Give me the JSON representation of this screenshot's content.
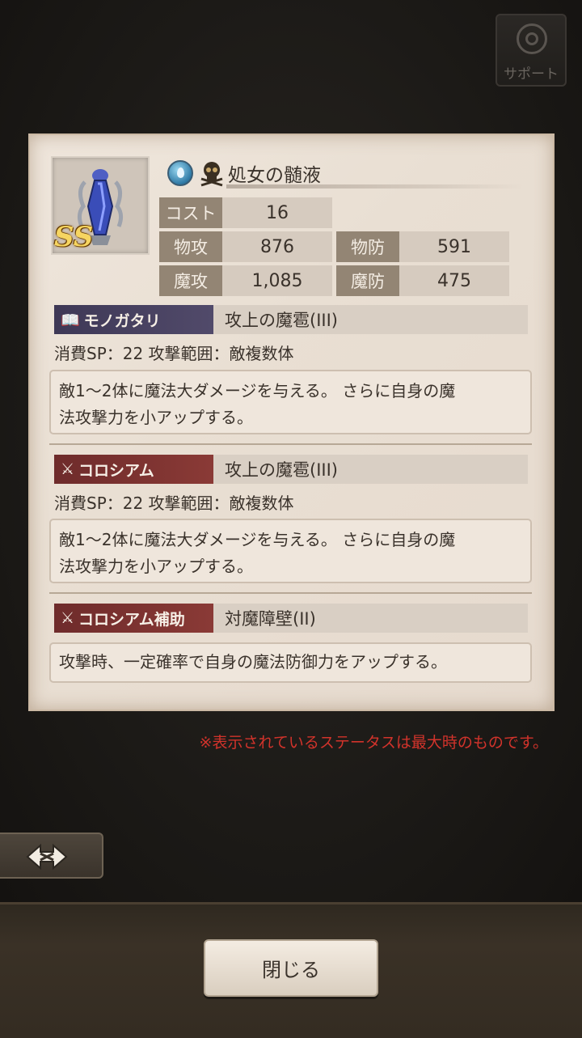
{
  "support": {
    "label": "サポート",
    "icon": "headset-icon"
  },
  "item": {
    "name": "処女の髄液",
    "rank": "SS",
    "element_icon": "water-drop-icon",
    "type_icon": "skull-icon"
  },
  "stats": {
    "cost": {
      "label": "コスト",
      "value": "16"
    },
    "patk": {
      "label": "物攻",
      "value": "876"
    },
    "pdef": {
      "label": "物防",
      "value": "591"
    },
    "matk": {
      "label": "魔攻",
      "value": "1,085"
    },
    "mdef": {
      "label": "魔防",
      "value": "475"
    }
  },
  "story_skill": {
    "tag": "モノガタリ",
    "tag_icon": "book-icon",
    "name": "攻上の魔雹(III)",
    "sp_line": "消費SP：22 攻撃範囲：敵複数体",
    "desc_line1": "敵1～2体に魔法大ダメージを与える。 さらに自身の魔",
    "desc_line2": "法攻撃力を小アップする。"
  },
  "colo_skill": {
    "tag": "コロシアム",
    "tag_icon": "crossed-swords-icon",
    "name": "攻上の魔雹(III)",
    "sp_line": "消費SP：22 攻撃範囲：敵複数体",
    "desc_line1": "敵1～2体に魔法大ダメージを与える。 さらに自身の魔",
    "desc_line2": "法攻撃力を小アップする。"
  },
  "colo_support": {
    "tag": "コロシアム補助",
    "tag_icon": "crossed-swords-support-icon",
    "name": "対魔障壁(II)",
    "desc": "攻撃時、一定確率で自身の魔法防御力をアップする。"
  },
  "note": "※表示されているステータスは最大時のものです。",
  "back_icon": "swap-arrows-icon",
  "close_label": "閉じる",
  "colors": {
    "note": "#d2332b",
    "story_tag": "#3e3856",
    "colo_tag": "#6e2b2b",
    "rank": "#f6d561"
  }
}
